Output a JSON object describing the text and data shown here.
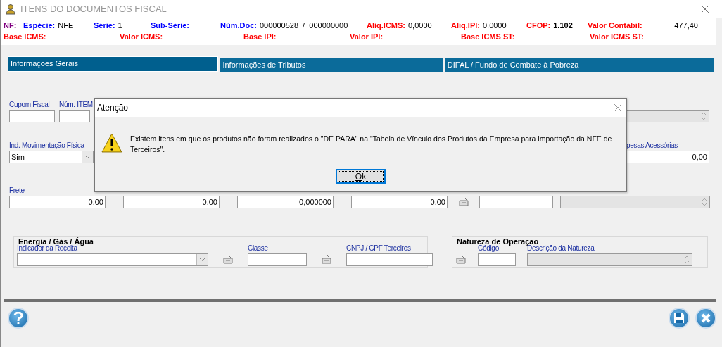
{
  "window": {
    "title": "ITENS DO DOCUMENTOS FISCAL"
  },
  "header": {
    "row1": [
      {
        "kind": "nf",
        "label": "NF:"
      },
      {
        "kind": "doc",
        "label": "Espécie:",
        "value": "NFE"
      },
      {
        "kind": "doc",
        "label": "Série:",
        "value": "1"
      },
      {
        "kind": "doc",
        "label": "Sub-Série:"
      },
      {
        "kind": "doc",
        "label": "Núm.Doc:",
        "value": "000000528  /  000000000"
      },
      {
        "kind": "tax",
        "label": "Alíq.ICMS:",
        "value": "0,0000"
      },
      {
        "kind": "tax",
        "label": "Alíq.IPI:",
        "value": "0,0000"
      },
      {
        "kind": "tax",
        "label": "CFOP:",
        "value": "1.102",
        "bold": true
      },
      {
        "kind": "tax",
        "label": "Valor Contábil:",
        "value": "477,40"
      }
    ],
    "row2": [
      {
        "kind": "tax",
        "label": "Base ICMS:"
      },
      {
        "kind": "tax",
        "label": "Valor ICMS:"
      },
      {
        "kind": "tax",
        "label": "Base IPI:"
      },
      {
        "kind": "tax",
        "label": "Valor IPI:"
      },
      {
        "kind": "tax",
        "label": "Base ICMS ST:"
      },
      {
        "kind": "tax",
        "label": "Valor ICMS ST:"
      }
    ]
  },
  "tabs": [
    {
      "label": "Informações Gerais",
      "selected": true
    },
    {
      "label": "Informações de Tributos",
      "selected": false
    },
    {
      "label": "DIFAL / Fundo de Combate à Pobreza",
      "selected": false
    }
  ],
  "form": {
    "row1": [
      {
        "kind": "text",
        "label": "Cupom Fiscal"
      },
      {
        "kind": "text",
        "label": "Núm. ITEM"
      },
      {
        "kind": "spin",
        "disabled": true
      }
    ],
    "row2": [
      {
        "kind": "combo",
        "label": "Ind. Movimentação Física",
        "value": "Sim"
      },
      {
        "kind": "text",
        "label": "pesas Acessórias",
        "value": "0,00"
      }
    ],
    "row3": [
      {
        "kind": "text",
        "label": "Frete",
        "value": "0,00"
      },
      {
        "kind": "text",
        "value": "0,00"
      },
      {
        "kind": "text",
        "value": "0,000000"
      },
      {
        "kind": "text",
        "value": "0,00"
      },
      {
        "kind": "lookup"
      },
      {
        "kind": "text"
      },
      {
        "kind": "spin",
        "disabled": true
      }
    ]
  },
  "groups": [
    {
      "title": "Energia / Gás / Água",
      "fields": [
        {
          "kind": "combo",
          "label": "Indicador da Receita"
        },
        {
          "kind": "lookup"
        },
        {
          "kind": "text",
          "label": "Classe"
        },
        {
          "kind": "lookup"
        },
        {
          "kind": "text",
          "label": "CNPJ / CPF Terceiros"
        }
      ]
    },
    {
      "title": "Natureza de Operação",
      "fields": [
        {
          "kind": "lookup"
        },
        {
          "kind": "text",
          "label": "Código"
        },
        {
          "kind": "spin",
          "label": "Descrição da Natureza",
          "disabled": true
        }
      ]
    }
  ],
  "dialog": {
    "title": "Atenção",
    "message": "Existem itens em que os produtos não foram realizados o \"DE PARA\" na \"Tabela de Vínculo dos Produtos da Empresa para importação da NFE de Terceiros\".",
    "button": "Ok"
  }
}
